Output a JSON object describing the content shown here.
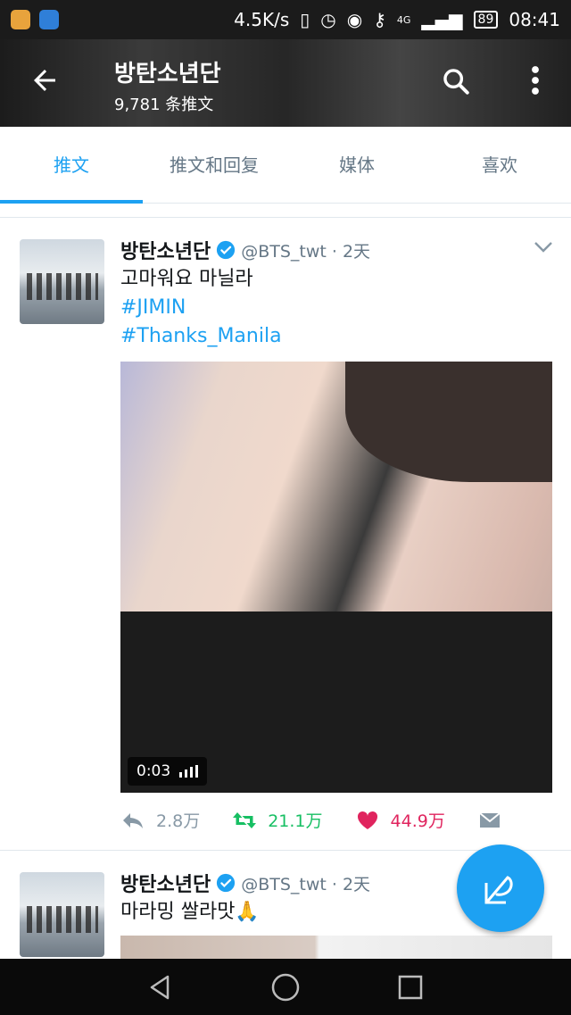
{
  "status_bar": {
    "speed": "4.5K/s",
    "network": "4G",
    "battery": "89",
    "time": "08:41"
  },
  "header": {
    "title": "방탄소년단",
    "subtitle": "9,781 条推文"
  },
  "tabs": [
    {
      "label": "推文",
      "active": true
    },
    {
      "label": "推文和回复",
      "active": false
    },
    {
      "label": "媒体",
      "active": false
    },
    {
      "label": "喜欢",
      "active": false
    }
  ],
  "tweets": [
    {
      "name": "방탄소년단",
      "handle": "@BTS_twt · 2天",
      "text": "고마워요 마닐라",
      "hashtags": [
        "#JIMIN",
        "#Thanks_Manila"
      ],
      "video_duration": "0:03",
      "reply_count": "2.8万",
      "retweet_count": "21.1万",
      "like_count": "44.9万"
    },
    {
      "name": "방탄소년단",
      "handle": "@BTS_twt · 2天",
      "text": "마라밍 쌀라맛🙏"
    }
  ],
  "colors": {
    "accent": "#1da1f2",
    "retweet": "#17bf63",
    "like": "#e0245e"
  }
}
